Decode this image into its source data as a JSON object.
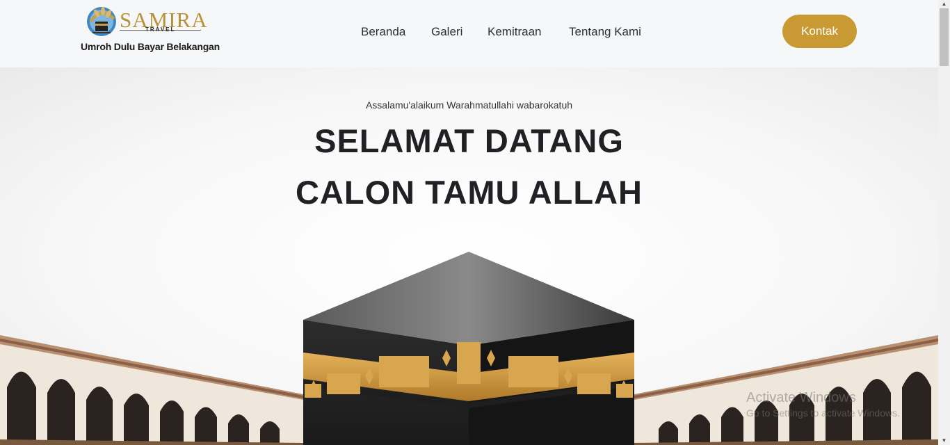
{
  "header": {
    "logo_text": "SAMIRA",
    "logo_subtext": "TRAVEL",
    "tagline": "Umroh Dulu Bayar Belakangan",
    "nav": [
      "Beranda",
      "Galeri",
      "Kemitraan",
      "Tentang Kami"
    ],
    "contact_button": "Kontak"
  },
  "hero": {
    "greeting": "Assalamu'alaikum Warahmatullahi wabarokatuh",
    "title_line1": "SELAMAT DATANG",
    "title_line2": "CALON TAMU ALLAH"
  },
  "watermark": {
    "line1": "Activate Windows",
    "line2": "Go to Settings to activate Windows."
  },
  "colors": {
    "accent": "#c99a33",
    "header_bg": "#f6f7f8",
    "title": "#1f2124"
  }
}
